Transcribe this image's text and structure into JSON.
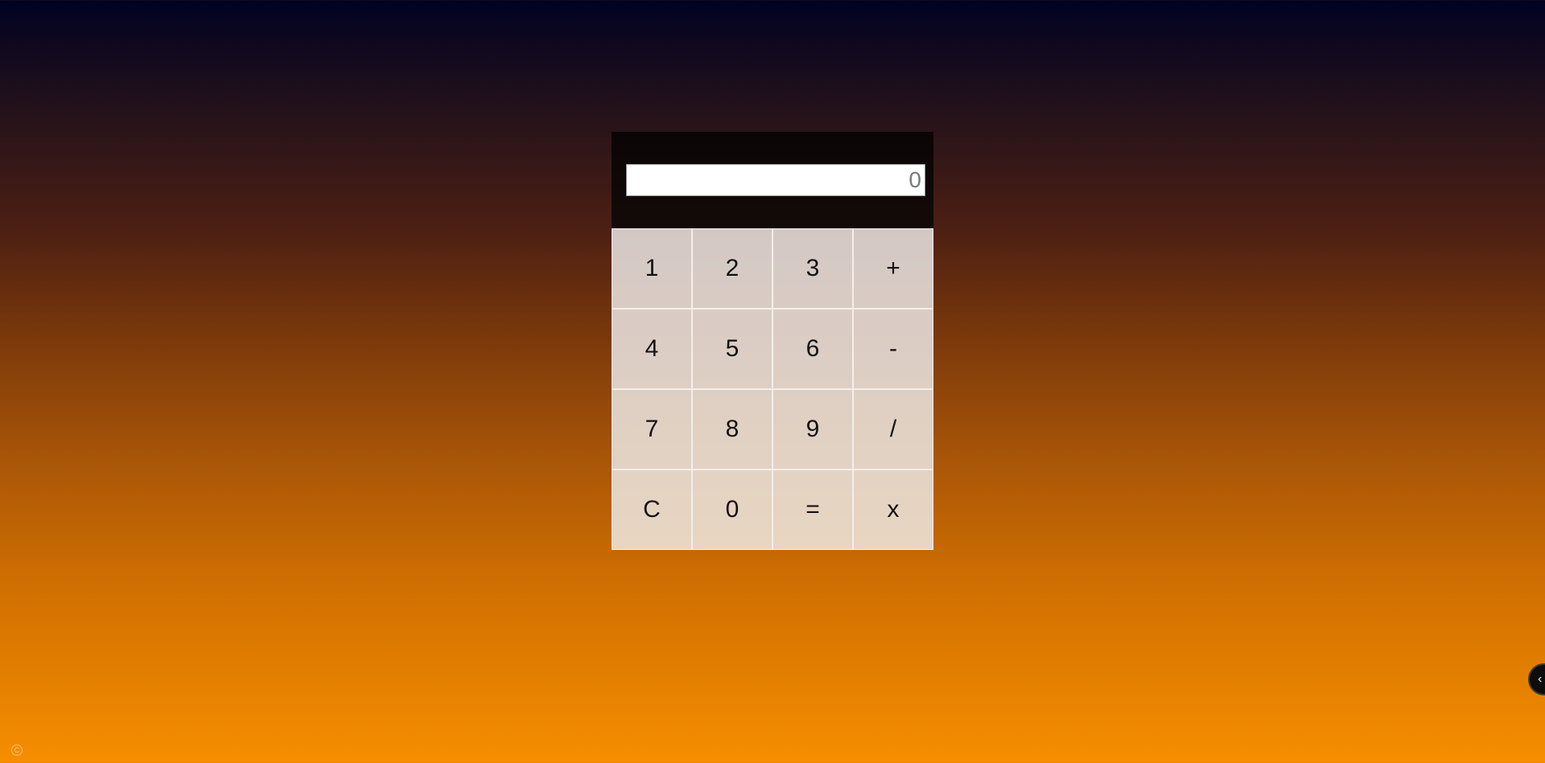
{
  "calculator": {
    "display_value": "0",
    "keys": [
      {
        "label": "1",
        "name": "key-1"
      },
      {
        "label": "2",
        "name": "key-2"
      },
      {
        "label": "3",
        "name": "key-3"
      },
      {
        "label": "+",
        "name": "key-add"
      },
      {
        "label": "4",
        "name": "key-4"
      },
      {
        "label": "5",
        "name": "key-5"
      },
      {
        "label": "6",
        "name": "key-6"
      },
      {
        "label": "-",
        "name": "key-subtract"
      },
      {
        "label": "7",
        "name": "key-7"
      },
      {
        "label": "8",
        "name": "key-8"
      },
      {
        "label": "9",
        "name": "key-9"
      },
      {
        "label": "/",
        "name": "key-divide"
      },
      {
        "label": "C",
        "name": "key-clear"
      },
      {
        "label": "0",
        "name": "key-0"
      },
      {
        "label": "=",
        "name": "key-equals"
      },
      {
        "label": "x",
        "name": "key-multiply"
      }
    ]
  },
  "side_toggle": {
    "icon": "chevron-left-icon",
    "glyph": "‹"
  },
  "corner_mark": {
    "icon": "copyright-icon",
    "glyph": "C"
  },
  "colors": {
    "gradient_top": "#010222",
    "gradient_bottom": "#f78e00",
    "display_panel": "#0a0505",
    "keypad_top": "#d4c8c5",
    "keypad_bottom": "#e8d6c2"
  }
}
